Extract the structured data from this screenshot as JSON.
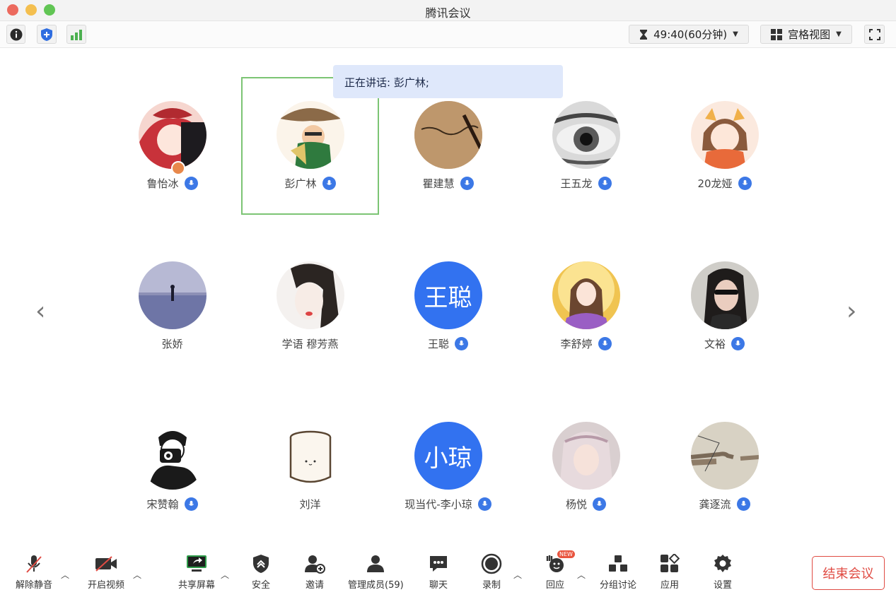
{
  "window": {
    "title": "腾讯会议"
  },
  "toolbar": {
    "timer": "49:40(60分钟)",
    "view_mode": "宫格视图"
  },
  "speaking_banner": "正在讲话: 彭广林;",
  "participants": [
    {
      "name": "鲁怡冰",
      "mic": true,
      "host": true
    },
    {
      "name": "彭广林",
      "mic": true,
      "host": false,
      "active": true
    },
    {
      "name": "瞿建慧",
      "mic": true,
      "host": false
    },
    {
      "name": "王五龙",
      "mic": true,
      "host": false
    },
    {
      "name": "20龙娅",
      "mic": true,
      "host": false
    },
    {
      "name": "张娇",
      "mic": false,
      "host": false
    },
    {
      "name": "学语 穆芳燕",
      "mic": false,
      "host": false
    },
    {
      "name": "王聪",
      "mic": true,
      "host": false,
      "avatar_text": "王聪"
    },
    {
      "name": "李舒婷",
      "mic": true,
      "host": false
    },
    {
      "name": "文裕",
      "mic": true,
      "host": false
    },
    {
      "name": "宋赞翰",
      "mic": true,
      "host": false
    },
    {
      "name": "刘洋",
      "mic": false,
      "host": false
    },
    {
      "name": "现当代-李小琼",
      "mic": true,
      "host": false,
      "avatar_text": "小琼"
    },
    {
      "name": "杨悦",
      "mic": true,
      "host": false
    },
    {
      "name": "龚逐流",
      "mic": true,
      "host": false
    }
  ],
  "bottom_bar": {
    "unmute": "解除静音",
    "start_video": "开启视频",
    "share_screen": "共享屏幕",
    "security": "安全",
    "invite": "邀请",
    "manage_members": "管理成员(59)",
    "chat": "聊天",
    "record": "录制",
    "reaction": "回应",
    "reaction_badge": "NEW",
    "breakout": "分组讨论",
    "apps": "应用",
    "settings": "设置",
    "end_meeting": "结束会议"
  },
  "colors": {
    "accent_blue": "#3272f0",
    "active_border": "#7cc474",
    "end_red": "#e04b43",
    "banner_bg": "#dfe8fb"
  }
}
